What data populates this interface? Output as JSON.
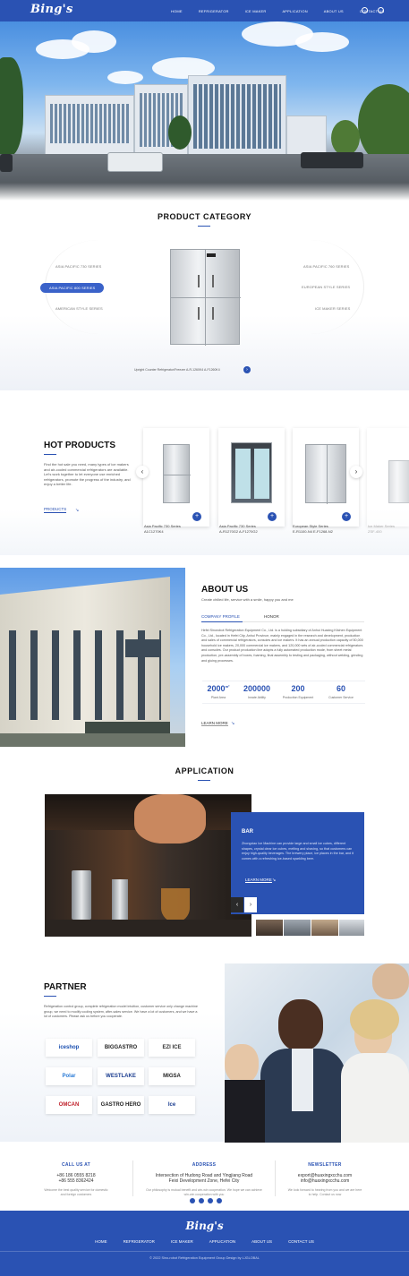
{
  "brand": {
    "logo": "Bing's"
  },
  "nav": {
    "items": [
      "HOME",
      "REFRIGERATOR",
      "ICE MAKER",
      "APPLICATION",
      "ABOUT US",
      "CONTACT US"
    ]
  },
  "category": {
    "title": "PRODUCT CATEGORY",
    "left": [
      "ASIA PACIFIC 730 SERIES",
      "ASIA PACIFIC 800 SERIES",
      "AMERICAN STYLE SERIES"
    ],
    "right": [
      "ASIA PACIFIC 760 SERIES",
      "EUROPEAN STYLE SERIES",
      "ICE MAKER SERIES"
    ],
    "product_caption": "Upright Counter Refrigerator/Freezer    A-R-1260K4 A-F1260K4"
  },
  "hot": {
    "title": "HOT PRODUCTS",
    "desc": "Find the hot sale you need, many types of ice makers and air-cooled commercial refrigerators are available. Let's work together to let everyone use enriched refrigerators, promote the progress of the industry, and enjoy a better life.",
    "link": "PRODUCTS",
    "products": [
      {
        "name": "Asia Pacific 730 Series",
        "model": "A1C1270K4"
      },
      {
        "name": "Asia Pacific 730 Series",
        "model": "A-R1270G2 A-F1270G2"
      },
      {
        "name": "European Style Series",
        "model": "E-R1100-N4 E-F1268-N2"
      },
      {
        "name": "Ice Maker Series",
        "model": "ZSF-400"
      }
    ]
  },
  "about": {
    "title": "ABOUT US",
    "subtitle": "Create chilled life, service with a smile, happy you and me",
    "tabs": [
      "COMPANY PROFILE",
      "HONOR"
    ],
    "text": "Hefei Sinorobot Refrigeration Equipment Co., Ltd. is a holding subsidiary of Anhui Huaxing Kitchen Equipment Co., Ltd., located in Hefei City, Anhui Province, mainly engaged in the research and development, production and sales of commercial refrigerators, consoles and ice makers. It has an annual production capacity of 50,000 household ice makers, 20,000 commercial ice makers, and 120,000 sets of air-cooled commercial refrigerators and consoles. Our product production line adopts a fully automated production mode, from sheet metal production, pre-assembly of boxes, foaming, final assembly to testing and packaging, without welding, grinding and gluing processes.",
    "stats": [
      {
        "num": "2000",
        "unit": "m²",
        "label": "Plant Area"
      },
      {
        "num": "200000",
        "unit": "",
        "label": "Innate Ability"
      },
      {
        "num": "200",
        "unit": "",
        "label": "Production Equipment"
      },
      {
        "num": "60",
        "unit": "",
        "label": "Customer Service"
      }
    ],
    "link": "LEARN MORE"
  },
  "application": {
    "title": "APPLICATION",
    "box_title": "BAR",
    "box_text": "Zhongxiao Ice Machine can provide large and small ice cubes, different shapes, crystal clear ice cubes, melting and shaving, so that customers can enjoy high-quality beverages. The brewery place, ice places in the bar, and it comes with a refreshing ice-based sparkling beer.",
    "box_link": "LEARN MORE"
  },
  "partner": {
    "title": "PARTNER",
    "desc": "Refrigeration control group, complete refrigeration model intuition, customer service only change machine group, we need to modify cooling system, after-sales service. We have a lot of customers, and we have a lot of customers. Please ask us before you cooperate.",
    "logos": [
      "iceshop",
      "BIGGASTRO",
      "EZI ICE",
      "Polar",
      "WESTLAKE",
      "MIGSA",
      "OMCAN",
      "GASTRO HERO",
      "Ice"
    ]
  },
  "contact": {
    "call": {
      "title": "CALL US AT",
      "phones": [
        "+86 186 0555 8218",
        "+86 555 8362424"
      ],
      "note": "Welcome the best quality service for domestic and foreign customers"
    },
    "address": {
      "title": "ADDRESS",
      "lines": [
        "Intersection of Hudong Road and Yingjiang Road",
        "Feixi Development Zone, Hefei City"
      ],
      "note": "Our philosophy is mutual benefit and win-win cooperation. We hope we can achieve win-win cooperation with you"
    },
    "newsletter": {
      "title": "NEWSLETTER",
      "emails": [
        "export@huaxingxcchu.com",
        "info@huaxingxcchu.com"
      ],
      "note": "We look forward to hearing from you and we are here to help. Contact us now"
    }
  },
  "footer": {
    "logo": "Bing's",
    "nav": [
      "HOME",
      "REFRIGERATOR",
      "ICE MAKER",
      "APPLICATION",
      "ABOUT US",
      "CONTACT US"
    ],
    "copyright": "© 2022 Sino-robot Refrigeration Equipment Group Design by LJGLOBAL"
  },
  "colors": {
    "primary": "#2a52b3",
    "accent": "#3a62c9"
  }
}
